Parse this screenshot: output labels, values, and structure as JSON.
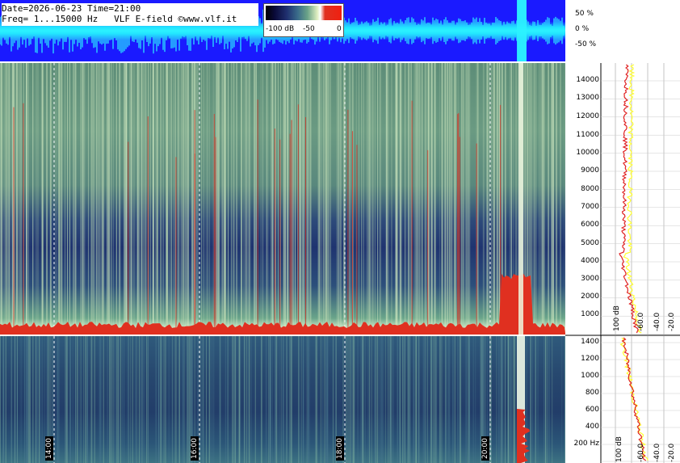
{
  "header": {
    "line1": "Date=2026-06-23 Time=21:00",
    "line2": "Freq= 1...15000 Hz   VLF E-field ©www.vlf.it"
  },
  "colorbar": {
    "labels": [
      "-100 dB",
      "-50",
      "0"
    ]
  },
  "amplitude_scale": [
    "50 %",
    "0 %",
    "-50 %"
  ],
  "freq_scale_main": [
    "14000",
    "13000",
    "12000",
    "11000",
    "10000",
    "9000",
    "8000",
    "7000",
    "6000",
    "5000",
    "4000",
    "3000",
    "2000",
    "1000"
  ],
  "freq_scale_low": [
    "1400",
    "1200",
    "1000",
    "800",
    "600",
    "400",
    "200 Hz"
  ],
  "db_labels_main": [
    "100 dB",
    "-60.0",
    "-40.0",
    "-20.0"
  ],
  "db_labels_low": [
    "100 dB",
    "-60.0",
    "-40.0",
    "-20.0"
  ],
  "time_labels": [
    "14:00",
    "16:00",
    "18:00",
    "20:00"
  ],
  "colors": {
    "waveform_bg": "#1a1aff",
    "waveform_trace": "#2cf2ff",
    "spectrum_peak": "#e03020",
    "profile_red": "#e02020",
    "profile_yellow": "#ffff30"
  }
}
